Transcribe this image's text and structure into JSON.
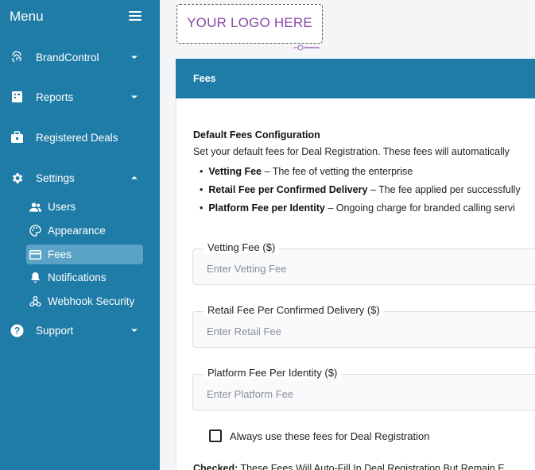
{
  "sidebar": {
    "title": "Menu",
    "items": [
      {
        "label": "BrandControl",
        "icon": "fingerprint-icon"
      },
      {
        "label": "Reports",
        "icon": "report-icon"
      },
      {
        "label": "Registered Deals",
        "icon": "briefcase-icon"
      },
      {
        "label": "Settings",
        "icon": "gear-icon"
      },
      {
        "label": "Support",
        "icon": "help-icon"
      }
    ],
    "settings_subitems": [
      {
        "label": "Users",
        "icon": "users-icon"
      },
      {
        "label": "Appearance",
        "icon": "palette-icon"
      },
      {
        "label": "Fees",
        "icon": "credit-card-icon",
        "active": true
      },
      {
        "label": "Notifications",
        "icon": "bell-icon"
      },
      {
        "label": "Webhook Security",
        "icon": "webhook-icon"
      }
    ]
  },
  "logo": {
    "text": "YOUR LOGO HERE"
  },
  "card": {
    "title": "Fees",
    "section_title": "Default Fees Configuration",
    "description": "Set your default fees for Deal Registration. These fees will automatically",
    "bullets": [
      {
        "term": "Vetting Fee",
        "text": " – The fee of vetting the enterprise"
      },
      {
        "term": "Retail Fee per Confirmed Delivery",
        "text": " – The fee applied per successfully"
      },
      {
        "term": "Platform Fee per Identity",
        "text": " – Ongoing charge for branded calling servi"
      }
    ],
    "fields": [
      {
        "label": "Vetting Fee ($)",
        "placeholder": "Enter Vetting Fee",
        "value": ""
      },
      {
        "label": "Retail Fee Per Confirmed Delivery ($)",
        "placeholder": "Enter Retail Fee",
        "value": ""
      },
      {
        "label": "Platform Fee Per Identity ($)",
        "placeholder": "Enter Platform Fee",
        "value": ""
      }
    ],
    "checkbox_label": "Always use these fees for Deal Registration",
    "footnote_term": "Checked:",
    "footnote_text": " These Fees Will Auto-Fill In Deal Registration But Remain E"
  },
  "colors": {
    "sidebar": "#1f7ca6",
    "active_item": "#5ba3c6",
    "logo_text": "#8b47a8"
  }
}
